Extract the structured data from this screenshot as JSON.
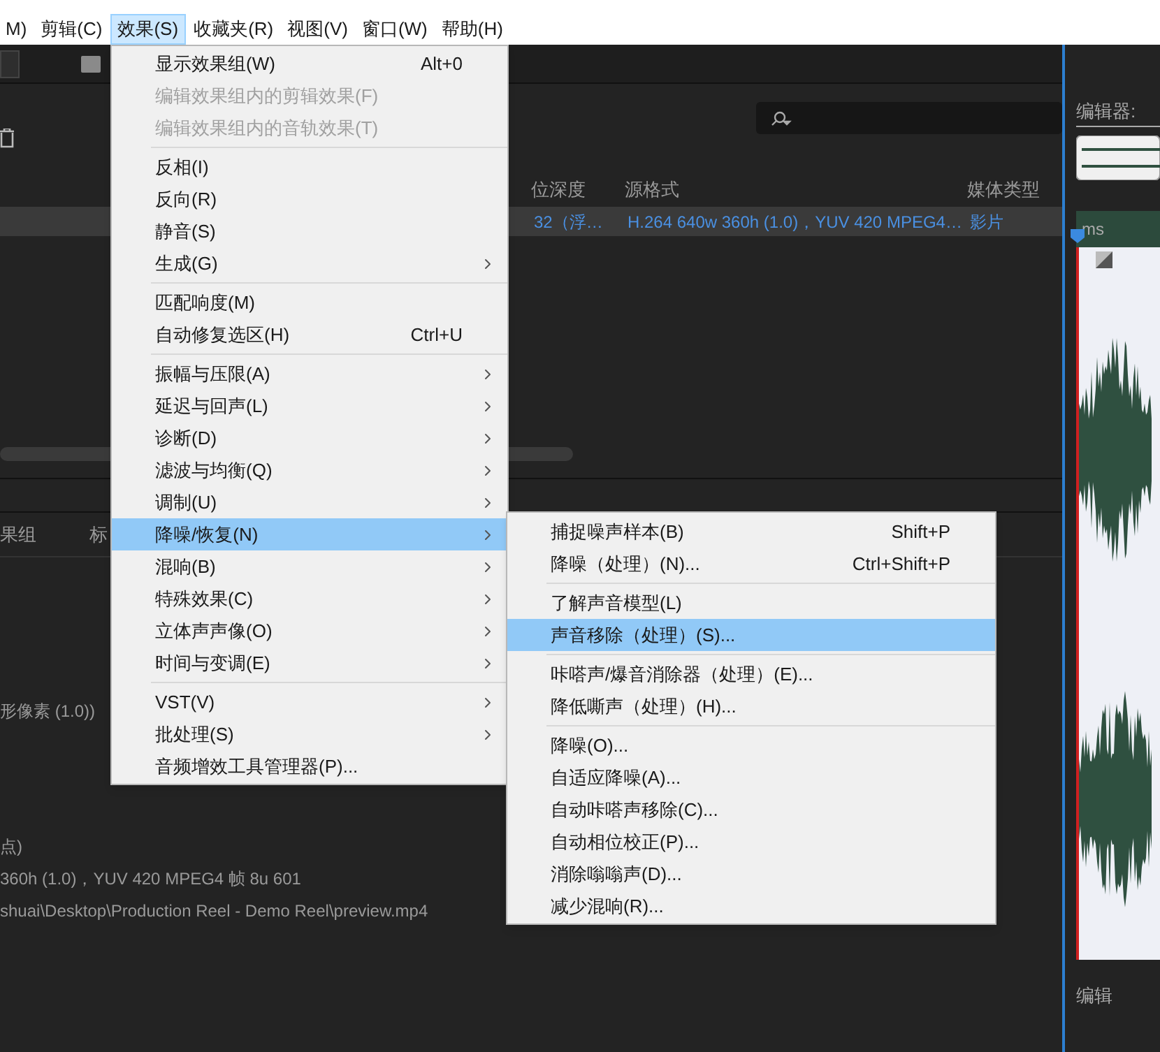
{
  "menu_bar": [
    {
      "label": "M)",
      "selected": false
    },
    {
      "label": "剪辑(C)",
      "selected": false
    },
    {
      "label": "效果(S)",
      "selected": true
    },
    {
      "label": "收藏夹(R)",
      "selected": false
    },
    {
      "label": "视图(V)",
      "selected": false
    },
    {
      "label": "窗口(W)",
      "selected": false
    },
    {
      "label": "帮助(H)",
      "selected": false
    }
  ],
  "media_panel": {
    "columns": [
      "位深度",
      "源格式",
      "媒体类型"
    ],
    "rows": [
      {
        "selected": true,
        "cells": [
          "32（浮…",
          "H.264 640w 360h (1.0)，YUV 420 MPEG4…",
          "影片"
        ]
      }
    ]
  },
  "properties_panel": {
    "tabs": [
      "果组",
      "标"
    ],
    "lines": [
      "形像素 (1.0))",
      "点)",
      "360h (1.0)，YUV 420 MPEG4 帧 8u 601",
      "shuai\\Desktop\\Production Reel - Demo Reel\\preview.mp4"
    ]
  },
  "editor_panel": {
    "tab": "编辑器:",
    "ruler_label": "ms",
    "bottom_tab": "编辑"
  },
  "effects_menu": [
    {
      "kind": "item",
      "label": "显示效果组(W)",
      "shortcut": "Alt+0",
      "disabled": false,
      "has_submenu": false,
      "selected": false
    },
    {
      "kind": "item",
      "label": "编辑效果组内的剪辑效果(F)",
      "disabled": true,
      "has_submenu": false,
      "selected": false
    },
    {
      "kind": "item",
      "label": "编辑效果组内的音轨效果(T)",
      "disabled": true,
      "has_submenu": false,
      "selected": false
    },
    {
      "kind": "separator"
    },
    {
      "kind": "item",
      "label": "反相(I)",
      "disabled": false,
      "has_submenu": false,
      "selected": false
    },
    {
      "kind": "item",
      "label": "反向(R)",
      "disabled": false,
      "has_submenu": false,
      "selected": false
    },
    {
      "kind": "item",
      "label": "静音(S)",
      "disabled": false,
      "has_submenu": false,
      "selected": false
    },
    {
      "kind": "item",
      "label": "生成(G)",
      "disabled": false,
      "has_submenu": true,
      "selected": false
    },
    {
      "kind": "separator"
    },
    {
      "kind": "item",
      "label": "匹配响度(M)",
      "disabled": false,
      "has_submenu": false,
      "selected": false
    },
    {
      "kind": "item",
      "label": "自动修复选区(H)",
      "shortcut": "Ctrl+U",
      "disabled": false,
      "has_submenu": false,
      "selected": false
    },
    {
      "kind": "separator"
    },
    {
      "kind": "item",
      "label": "振幅与压限(A)",
      "disabled": false,
      "has_submenu": true,
      "selected": false
    },
    {
      "kind": "item",
      "label": "延迟与回声(L)",
      "disabled": false,
      "has_submenu": true,
      "selected": false
    },
    {
      "kind": "item",
      "label": "诊断(D)",
      "disabled": false,
      "has_submenu": true,
      "selected": false
    },
    {
      "kind": "item",
      "label": "滤波与均衡(Q)",
      "disabled": false,
      "has_submenu": true,
      "selected": false
    },
    {
      "kind": "item",
      "label": "调制(U)",
      "disabled": false,
      "has_submenu": true,
      "selected": false
    },
    {
      "kind": "item",
      "label": "降噪/恢复(N)",
      "disabled": false,
      "has_submenu": true,
      "selected": true
    },
    {
      "kind": "item",
      "label": "混响(B)",
      "disabled": false,
      "has_submenu": true,
      "selected": false
    },
    {
      "kind": "item",
      "label": "特殊效果(C)",
      "disabled": false,
      "has_submenu": true,
      "selected": false
    },
    {
      "kind": "item",
      "label": "立体声声像(O)",
      "disabled": false,
      "has_submenu": true,
      "selected": false
    },
    {
      "kind": "item",
      "label": "时间与变调(E)",
      "disabled": false,
      "has_submenu": true,
      "selected": false
    },
    {
      "kind": "separator"
    },
    {
      "kind": "item",
      "label": "VST(V)",
      "disabled": false,
      "has_submenu": true,
      "selected": false
    },
    {
      "kind": "item",
      "label": "批处理(S)",
      "disabled": false,
      "has_submenu": true,
      "selected": false
    },
    {
      "kind": "item",
      "label": "音频增效工具管理器(P)...",
      "disabled": false,
      "has_submenu": false,
      "selected": false
    }
  ],
  "noise_submenu": [
    {
      "kind": "item",
      "label": "捕捉噪声样本(B)",
      "shortcut": "Shift+P",
      "disabled": false,
      "has_submenu": false,
      "selected": false
    },
    {
      "kind": "item",
      "label": "降噪（处理）(N)...",
      "shortcut": "Ctrl+Shift+P",
      "disabled": false,
      "has_submenu": false,
      "selected": false
    },
    {
      "kind": "separator"
    },
    {
      "kind": "item",
      "label": "了解声音模型(L)",
      "disabled": false,
      "has_submenu": false,
      "selected": false
    },
    {
      "kind": "item",
      "label": "声音移除（处理）(S)...",
      "disabled": false,
      "has_submenu": false,
      "selected": true
    },
    {
      "kind": "separator"
    },
    {
      "kind": "item",
      "label": "咔嗒声/爆音消除器（处理）(E)...",
      "disabled": false,
      "has_submenu": false,
      "selected": false
    },
    {
      "kind": "item",
      "label": "降低嘶声（处理）(H)...",
      "disabled": false,
      "has_submenu": false,
      "selected": false
    },
    {
      "kind": "separator"
    },
    {
      "kind": "item",
      "label": "降噪(O)...",
      "disabled": false,
      "has_submenu": false,
      "selected": false
    },
    {
      "kind": "item",
      "label": "自适应降噪(A)...",
      "disabled": false,
      "has_submenu": false,
      "selected": false
    },
    {
      "kind": "item",
      "label": "自动咔嗒声移除(C)...",
      "disabled": false,
      "has_submenu": false,
      "selected": false
    },
    {
      "kind": "item",
      "label": "自动相位校正(P)...",
      "disabled": false,
      "has_submenu": false,
      "selected": false
    },
    {
      "kind": "item",
      "label": "消除嗡嗡声(D)...",
      "disabled": false,
      "has_submenu": false,
      "selected": false
    },
    {
      "kind": "item",
      "label": "减少混响(R)...",
      "disabled": false,
      "has_submenu": false,
      "selected": false
    }
  ]
}
